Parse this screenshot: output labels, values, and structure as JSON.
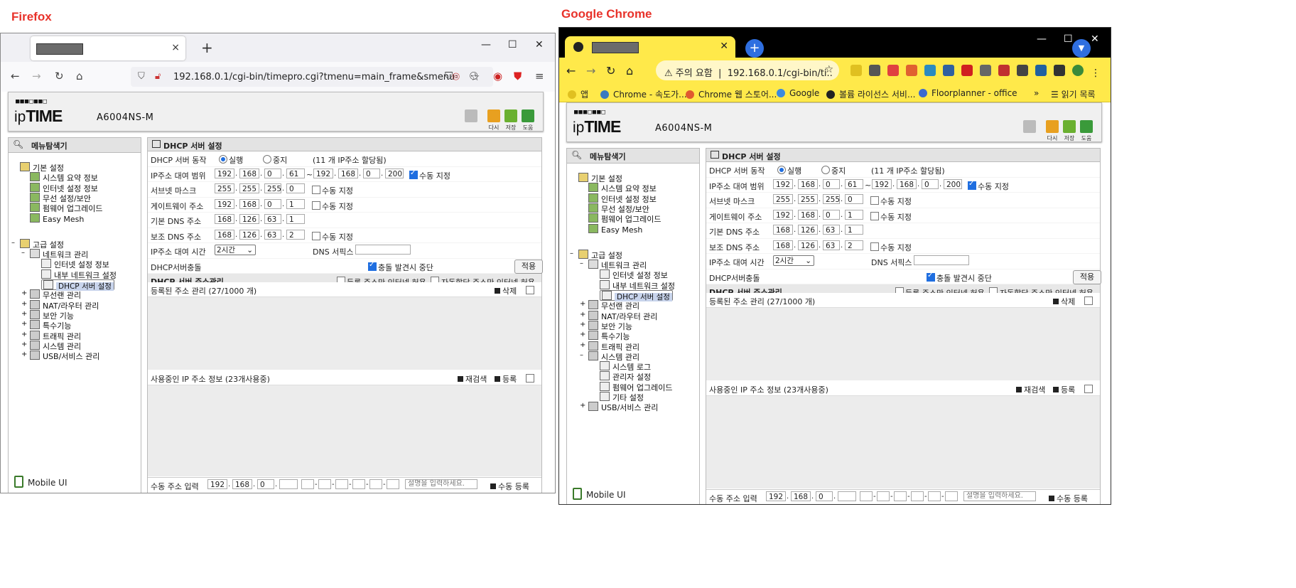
{
  "captions": {
    "firefox": "Firefox",
    "chrome": "Google Chrome"
  },
  "firefox": {
    "url_main": "192.168.0.1/cgi-bin/timepro.cgi?tmenu=main_frame&smenu=",
    "url_tail": "m",
    "new_tab": "+",
    "tab_close": "×"
  },
  "chrome": {
    "url_warning": "주의 요함",
    "url": "192.168.0.1/cgi-bin/ti...",
    "bookmarks": [
      "앱",
      "Chrome - 속도가...",
      "Chrome 웹 스토어...",
      "Google",
      "볼륨 라이선스 서비...",
      "Floorplanner - office"
    ],
    "reading_list": "읽기 목록",
    "more": "»"
  },
  "iptime": {
    "dots": "■■■□■■□",
    "logo_a": "ip",
    "logo_b": "TIME",
    "model": "A6004NS-M",
    "header_buttons": [
      "다시",
      "저장",
      "도움"
    ],
    "sidebar_title": "메뉴탐색기",
    "basic": "기본 설정",
    "basic_items": [
      "시스템 요약 정보",
      "인터넷 설정 정보",
      "무선 설정/보안",
      "펌웨어 업그레이드",
      "Easy Mesh"
    ],
    "advanced": "고급 설정",
    "network": "네트워크 관리",
    "network_items": [
      "인터넷 설정 정보",
      "내부 네트워크 설정",
      "DHCP 서버 설정"
    ],
    "adv_items": [
      "무선랜 관리",
      "NAT/라우터 관리",
      "보안 기능",
      "특수기능",
      "트래픽 관리",
      "시스템 관리",
      "USB/서비스 관리"
    ],
    "system_items": [
      "시스템 로그",
      "관리자 설정",
      "펌웨어 업그레이드",
      "기타 설정"
    ],
    "mobile": "Mobile UI",
    "section_title": "DHCP 서버 설정",
    "l_action": "DHCP 서버 동작",
    "run": "실행",
    "stop": "중지",
    "assigned": "(11 개 IP주소 할당됨)",
    "l_range": "IP주소 대여 범위",
    "range_start": [
      "192",
      "168",
      "0",
      "61"
    ],
    "tilde": "~",
    "range_end": [
      "192",
      "168",
      "0",
      "200"
    ],
    "manual": "수동 지정",
    "l_subnet": "서브넷 마스크",
    "subnet": [
      "255",
      "255",
      "255",
      "0"
    ],
    "l_gateway": "게이트웨이 주소",
    "gateway": [
      "192",
      "168",
      "0",
      "1"
    ],
    "l_dns1": "기본 DNS 주소",
    "dns1": [
      "168",
      "126",
      "63",
      "1"
    ],
    "l_dns2": "보조 DNS 주소",
    "dns2": [
      "168",
      "126",
      "63",
      "2"
    ],
    "l_lease": "IP주소 대여 시간",
    "lease": "2시간",
    "l_suffix": "DNS 서픽스",
    "l_conflict": "DHCP서버충돌",
    "conflict_stop": "충돌 발견시 중단",
    "apply": "적용",
    "mgmt_title": "DHCP 서버 주소관리",
    "only_registered": "등록 주소만 인터넷 허용",
    "only_auto": "자동할당 주소만 인터넷 허용",
    "registered": "등록된 주소 관리 (27/1000 개)",
    "delete": "삭제",
    "in_use": "사용중인 IP 주소 정보 (23개사용중)",
    "research": "재검색",
    "register": "등록",
    "manual_input": "수동 주소 입력",
    "manual_ip": [
      "192",
      "168",
      "0",
      ""
    ],
    "desc_placeholder": "설명을 입력하세요.",
    "manual_register": "수동 등록"
  }
}
